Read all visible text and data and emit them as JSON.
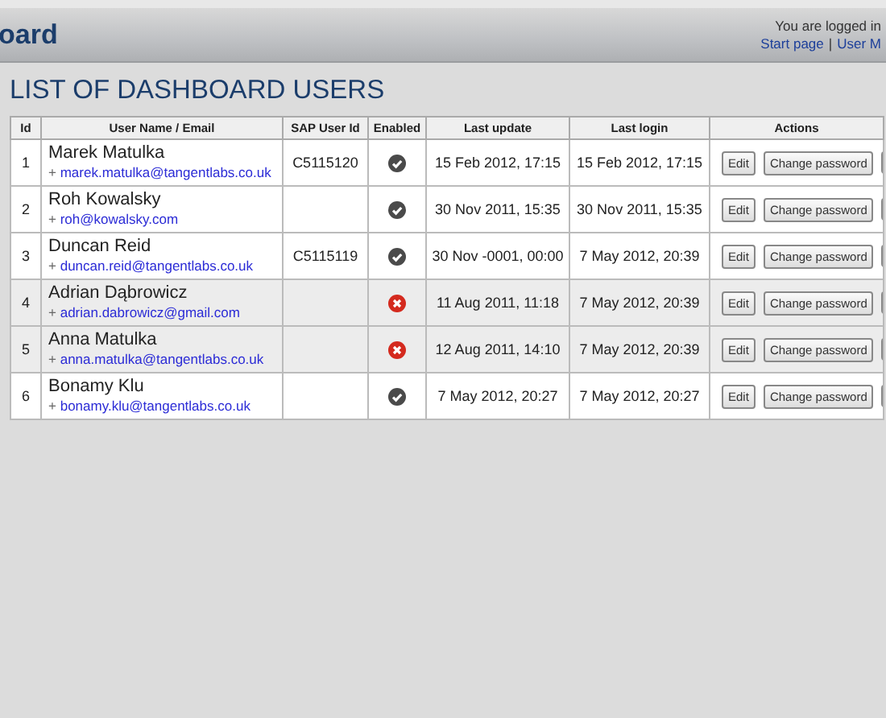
{
  "header": {
    "title": "oard",
    "login_text": "You are logged in",
    "links": [
      "Start page",
      "User M"
    ],
    "separator": "|"
  },
  "page_title": "LIST OF DASHBOARD USERS",
  "table": {
    "columns": [
      "Id",
      "User Name / Email",
      "SAP User Id",
      "Enabled",
      "Last update",
      "Last login",
      "Actions"
    ],
    "rows": [
      {
        "id": "1",
        "name": "Marek Matulka",
        "email_prefix": "+",
        "email": "marek.matulka@tangentlabs.co.uk",
        "sap_id": "C5115120",
        "enabled": true,
        "last_update": "15 Feb 2012, 17:15",
        "last_login": "15 Feb 2012, 17:15",
        "actions": [
          "Edit",
          "Change password"
        ]
      },
      {
        "id": "2",
        "name": "Roh Kowalsky",
        "email_prefix": "+",
        "email": "roh@kowalsky.com",
        "sap_id": "",
        "enabled": true,
        "last_update": "30 Nov 2011, 15:35",
        "last_login": "30 Nov 2011, 15:35",
        "actions": [
          "Edit",
          "Change password"
        ]
      },
      {
        "id": "3",
        "name": "Duncan Reid",
        "email_prefix": "+",
        "email": "duncan.reid@tangentlabs.co.uk",
        "sap_id": "C5115119",
        "enabled": true,
        "last_update": "30 Nov -0001, 00:00",
        "last_login": "7 May 2012, 20:39",
        "actions": [
          "Edit",
          "Change password"
        ]
      },
      {
        "id": "4",
        "name": "Adrian Dąbrowicz",
        "email_prefix": "+",
        "email": "adrian.dabrowicz@gmail.com",
        "sap_id": "",
        "enabled": false,
        "last_update": "11 Aug 2011, 11:18",
        "last_login": "7 May 2012, 20:39",
        "actions": [
          "Edit",
          "Change password"
        ]
      },
      {
        "id": "5",
        "name": "Anna Matulka",
        "email_prefix": "+",
        "email": "anna.matulka@tangentlabs.co.uk",
        "sap_id": "",
        "enabled": false,
        "last_update": "12 Aug 2011, 14:10",
        "last_login": "7 May 2012, 20:39",
        "actions": [
          "Edit",
          "Change password"
        ]
      },
      {
        "id": "6",
        "name": "Bonamy Klu",
        "email_prefix": "+",
        "email": "bonamy.klu@tangentlabs.co.uk",
        "sap_id": "",
        "enabled": true,
        "last_update": "7 May 2012, 20:27",
        "last_login": "7 May 2012, 20:27",
        "actions": [
          "Edit",
          "Change password"
        ]
      }
    ]
  }
}
